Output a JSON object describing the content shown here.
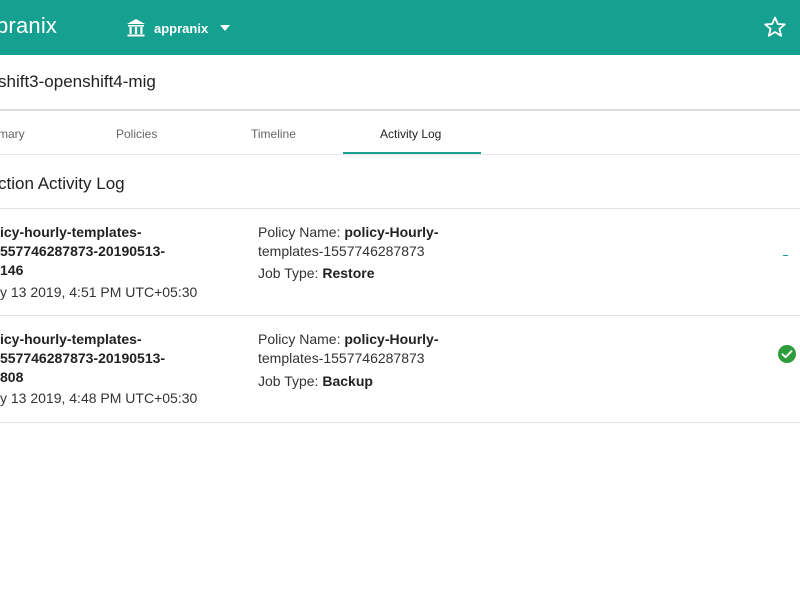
{
  "header": {
    "brand": "pranix",
    "tenant": "appranix",
    "icons": {
      "tenant": "bank-icon",
      "dropdown": "caret-down-icon",
      "favorite": "star-icon"
    },
    "colors": {
      "accent": "#15a08f"
    }
  },
  "subheader": {
    "title": "shift3-openshift4-mig"
  },
  "tabs": [
    {
      "label": "mary",
      "active": false
    },
    {
      "label": "Policies",
      "active": false
    },
    {
      "label": "Timeline",
      "active": false
    },
    {
      "label": "Activity Log",
      "active": true
    }
  ],
  "section": {
    "title": "ction Activity Log"
  },
  "jobs": [
    {
      "name_lines": [
        "icy-hourly-templates-",
        "557746287873-20190513-",
        "146"
      ],
      "date": "y 13 2019, 4:51 PM UTC+05:30",
      "policy_label": "Policy Name:",
      "policy_lines": [
        "policy-Hourly-",
        "templates-1557746287873"
      ],
      "job_type_label": "Job Type:",
      "job_type": "Restore",
      "status_icon": "in-progress-indicator"
    },
    {
      "name_lines": [
        "icy-hourly-templates-",
        "557746287873-20190513-",
        "808"
      ],
      "date": "y 13 2019, 4:48 PM UTC+05:30",
      "policy_label": "Policy Name:",
      "policy_lines": [
        "policy-Hourly-",
        "templates-1557746287873"
      ],
      "job_type_label": "Job Type:",
      "job_type": "Backup",
      "status_icon": "check-circle-icon",
      "status_color": "#2e9c3a"
    }
  ]
}
